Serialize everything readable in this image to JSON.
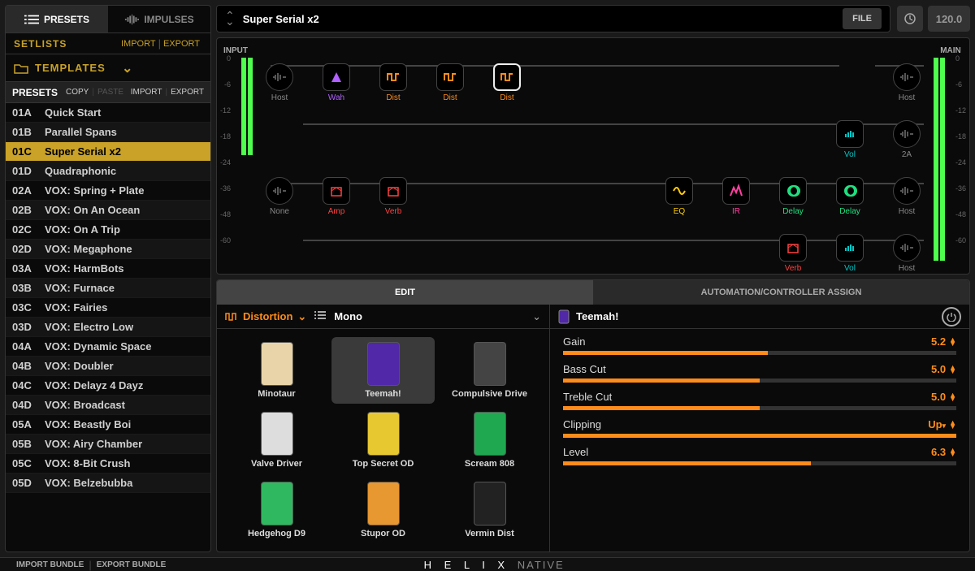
{
  "tabs": {
    "presets": "PRESETS",
    "impulses": "IMPULSES"
  },
  "setlists": {
    "label": "SETLISTS",
    "import": "IMPORT",
    "export": "EXPORT"
  },
  "templates": {
    "label": "TEMPLATES"
  },
  "presets_hdr": {
    "title": "PRESETS",
    "copy": "COPY",
    "paste": "PASTE",
    "import": "IMPORT",
    "export": "EXPORT"
  },
  "preset_list": [
    {
      "slot": "01A",
      "name": "Quick Start"
    },
    {
      "slot": "01B",
      "name": "Parallel Spans"
    },
    {
      "slot": "01C",
      "name": "Super Serial x2",
      "selected": true
    },
    {
      "slot": "01D",
      "name": "Quadraphonic"
    },
    {
      "slot": "02A",
      "name": "VOX: Spring + Plate"
    },
    {
      "slot": "02B",
      "name": "VOX: On An Ocean"
    },
    {
      "slot": "02C",
      "name": "VOX: On A Trip"
    },
    {
      "slot": "02D",
      "name": "VOX: Megaphone"
    },
    {
      "slot": "03A",
      "name": "VOX: HarmBots"
    },
    {
      "slot": "03B",
      "name": "VOX: Furnace"
    },
    {
      "slot": "03C",
      "name": "VOX: Fairies"
    },
    {
      "slot": "03D",
      "name": "VOX: Electro Low"
    },
    {
      "slot": "04A",
      "name": "VOX: Dynamic Space"
    },
    {
      "slot": "04B",
      "name": "VOX: Doubler"
    },
    {
      "slot": "04C",
      "name": "VOX: Delayz 4 Dayz"
    },
    {
      "slot": "04D",
      "name": "VOX: Broadcast"
    },
    {
      "slot": "05A",
      "name": "VOX: Beastly Boi"
    },
    {
      "slot": "05B",
      "name": "VOX: Airy Chamber"
    },
    {
      "slot": "05C",
      "name": "VOX: 8-Bit Crush"
    },
    {
      "slot": "05D",
      "name": "VOX: Belzebubba"
    }
  ],
  "current_preset": "Super Serial x2",
  "file_btn": "FILE",
  "tempo": "120.0",
  "meter": {
    "input": "INPUT",
    "main": "MAIN",
    "ticks": [
      "0",
      "-6",
      "-12",
      "-18",
      "-24",
      "-36",
      "-48",
      "-60"
    ]
  },
  "flow": {
    "row1": [
      {
        "type": "io",
        "label": "Host",
        "shape": "round"
      },
      {
        "type": "fx",
        "label": "Wah",
        "color": "purple"
      },
      {
        "type": "fx",
        "label": "Dist",
        "color": "orange"
      },
      {
        "type": "fx",
        "label": "Dist",
        "color": "orange"
      },
      {
        "type": "fx",
        "label": "Dist",
        "color": "orange",
        "hl": true
      }
    ],
    "row1_end": {
      "label": "Host",
      "shape": "round"
    },
    "row2_end": [
      {
        "label": "Vol",
        "color": "teal"
      },
      {
        "label": "2A",
        "shape": "round"
      }
    ],
    "row3": [
      {
        "type": "io",
        "label": "None",
        "shape": "round"
      },
      {
        "type": "fx",
        "label": "Amp",
        "color": "red"
      },
      {
        "type": "fx",
        "label": "Verb",
        "color": "red"
      }
    ],
    "row3_right": [
      {
        "type": "fx",
        "label": "EQ",
        "color": "yellow"
      },
      {
        "type": "fx",
        "label": "IR",
        "color": "pink"
      },
      {
        "type": "fx",
        "label": "Delay",
        "color": "green"
      },
      {
        "type": "fx",
        "label": "Delay",
        "color": "green"
      },
      {
        "type": "io",
        "label": "Host",
        "shape": "round"
      }
    ],
    "row4": [
      {
        "type": "fx",
        "label": "Verb",
        "color": "red"
      },
      {
        "type": "fx",
        "label": "Vol",
        "color": "teal"
      },
      {
        "type": "io",
        "label": "Host",
        "shape": "round"
      }
    ]
  },
  "edit_tabs": {
    "edit": "EDIT",
    "auto": "AUTOMATION/CONTROLLER ASSIGN"
  },
  "browser": {
    "category": "Distortion",
    "topology": "Mono"
  },
  "models": [
    {
      "name": "Minotaur",
      "bg": "#e8d4a8"
    },
    {
      "name": "Teemah!",
      "bg": "#5028a8",
      "sel": true
    },
    {
      "name": "Compulsive Drive",
      "bg": "#444"
    },
    {
      "name": "Valve Driver",
      "bg": "#ddd"
    },
    {
      "name": "Top Secret OD",
      "bg": "#e8c830"
    },
    {
      "name": "Scream 808",
      "bg": "#20a850"
    },
    {
      "name": "Hedgehog D9",
      "bg": "#30b860"
    },
    {
      "name": "Stupor OD",
      "bg": "#e89830"
    },
    {
      "name": "Vermin Dist",
      "bg": "#222"
    }
  ],
  "selected_model": "Teemah!",
  "params": [
    {
      "name": "Gain",
      "value": "5.2",
      "fill": 52
    },
    {
      "name": "Bass Cut",
      "value": "5.0",
      "fill": 50
    },
    {
      "name": "Treble Cut",
      "value": "5.0",
      "fill": 50
    },
    {
      "name": "Clipping",
      "value": "Up",
      "fill": 100,
      "enum": true
    },
    {
      "name": "Level",
      "value": "6.3",
      "fill": 63
    }
  ],
  "footer": {
    "import": "IMPORT BUNDLE",
    "export": "EXPORT BUNDLE",
    "logo": "H E L I X",
    "logo2": "NATIVE"
  }
}
